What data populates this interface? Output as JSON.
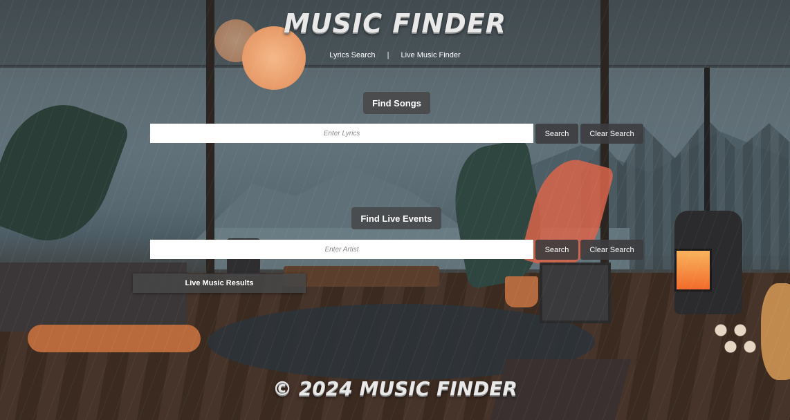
{
  "header": {
    "logo_text": "MUSIC FINDER"
  },
  "nav": {
    "lyrics_link": "Lyrics Search",
    "separator": "|",
    "live_link": "Live Music Finder"
  },
  "songs": {
    "title": "Find Songs",
    "input_value": "",
    "input_placeholder": "Enter Lyrics",
    "search_label": "Search",
    "clear_label": "Clear Search"
  },
  "live_events": {
    "title": "Find Live Events",
    "input_value": "",
    "input_placeholder": "Enter Artist",
    "search_label": "Search",
    "clear_label": "Clear Search",
    "results_label": "Live Music Results"
  },
  "footer": {
    "text": "© 2024 MUSIC FINDER"
  },
  "colors": {
    "panel_bg": "#464648",
    "text": "#ffffff",
    "lamp": "#e79a68",
    "fire": "#f26b2a"
  }
}
